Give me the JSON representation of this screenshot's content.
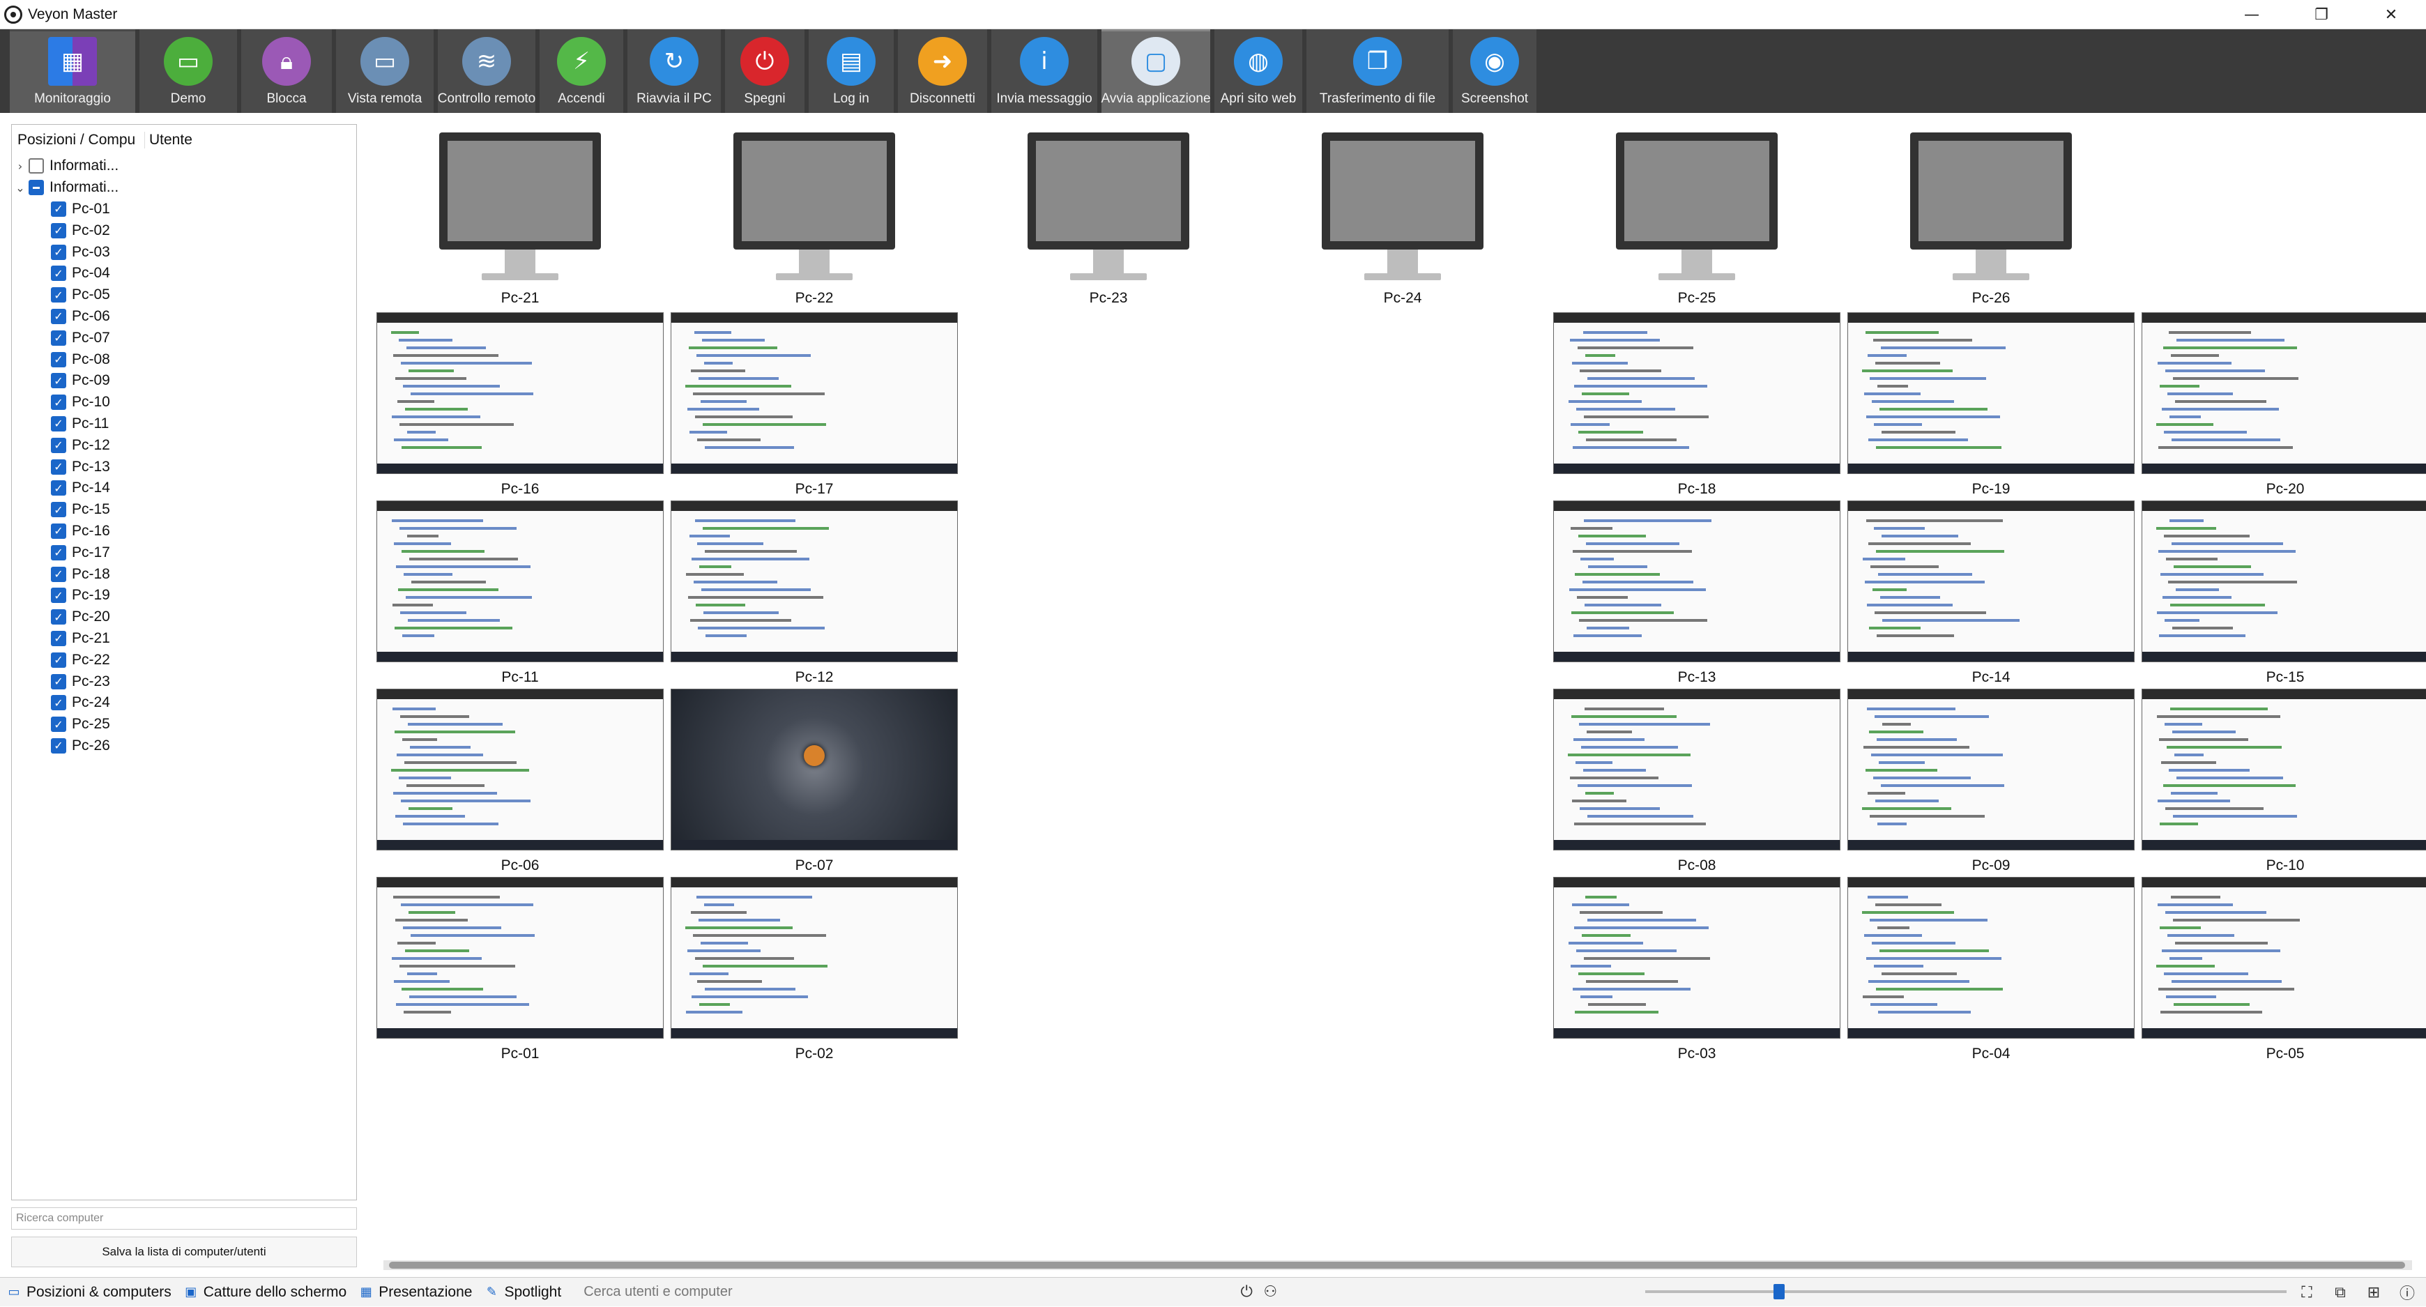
{
  "window": {
    "title": "Veyon Master",
    "controls": {
      "minimize": "—",
      "maximize": "❐",
      "close": "✕"
    }
  },
  "toolbar": [
    {
      "label": "Monitoraggio",
      "icon": "monitoring-grid-icon",
      "color": "#e23b3b",
      "state": "active"
    },
    {
      "label": "Demo",
      "icon": "demo-presentation-icon",
      "color": "#4cae3c",
      "state": ""
    },
    {
      "label": "Blocca",
      "icon": "lock-icon",
      "color": "#9b59b6",
      "state": ""
    },
    {
      "label": "Vista remota",
      "icon": "remote-view-icon",
      "color": "#6b8fb5",
      "state": ""
    },
    {
      "label": "Controllo remoto",
      "icon": "remote-control-icon",
      "color": "#6b8fb5",
      "state": ""
    },
    {
      "label": "Accendi",
      "icon": "power-on-icon",
      "color": "#54b848",
      "state": ""
    },
    {
      "label": "Riavvia il PC",
      "icon": "reboot-icon",
      "color": "#2e8de0",
      "state": ""
    },
    {
      "label": "Spegni",
      "icon": "power-off-icon",
      "color": "#d9262c",
      "state": ""
    },
    {
      "label": "Log in",
      "icon": "login-icon",
      "color": "#2e8de0",
      "state": ""
    },
    {
      "label": "Disconnetti",
      "icon": "logout-icon",
      "color": "#f0a020",
      "state": ""
    },
    {
      "label": "Invia messaggio",
      "icon": "message-icon",
      "color": "#2e8de0",
      "state": ""
    },
    {
      "label": "Avvia applicazione",
      "icon": "start-app-icon",
      "color": "#dfe8f2",
      "state": "highlight"
    },
    {
      "label": "Apri sito web",
      "icon": "globe-icon",
      "color": "#2e8de0",
      "state": ""
    },
    {
      "label": "Trasferimento di file",
      "icon": "file-transfer-icon",
      "color": "#2e8de0",
      "state": ""
    },
    {
      "label": "Screenshot",
      "icon": "camera-icon",
      "color": "#2e8de0",
      "state": ""
    }
  ],
  "tree": {
    "header": {
      "col1": "Posizioni / Compu",
      "col2": "Utente"
    },
    "groups": [
      {
        "label": "Informati...",
        "expanded": false,
        "state": "off"
      },
      {
        "label": "Informati...",
        "expanded": true,
        "state": "partial"
      }
    ],
    "computers": [
      "Pc-01",
      "Pc-02",
      "Pc-03",
      "Pc-04",
      "Pc-05",
      "Pc-06",
      "Pc-07",
      "Pc-08",
      "Pc-09",
      "Pc-10",
      "Pc-11",
      "Pc-12",
      "Pc-13",
      "Pc-14",
      "Pc-15",
      "Pc-16",
      "Pc-17",
      "Pc-18",
      "Pc-19",
      "Pc-20",
      "Pc-21",
      "Pc-22",
      "Pc-23",
      "Pc-24",
      "Pc-25",
      "Pc-26"
    ]
  },
  "search_computer_placeholder": "Ricerca computer",
  "save_list_label": "Salva la lista di computer/utenti",
  "monitors_offline": [
    "Pc-21",
    "Pc-22",
    "Pc-23",
    "Pc-24",
    "Pc-25",
    "Pc-26"
  ],
  "screens": {
    "row1": [
      "Pc-16",
      "Pc-17",
      "",
      "",
      "Pc-18",
      "Pc-19",
      "Pc-20"
    ],
    "row2": [
      "Pc-11",
      "Pc-12",
      "",
      "",
      "Pc-13",
      "Pc-14",
      "Pc-15"
    ],
    "row3": [
      "Pc-06",
      "Pc-07",
      "",
      "",
      "Pc-08",
      "Pc-09",
      "Pc-10"
    ],
    "row4": [
      "Pc-01",
      "Pc-02",
      "",
      "",
      "Pc-03",
      "Pc-04",
      "Pc-05"
    ]
  },
  "desktop_idle": "Pc-07",
  "bottombar": {
    "tabs": [
      "Posizioni & computers",
      "Catture dello schermo",
      "Presentazione",
      "Spotlight"
    ],
    "search_placeholder": "Cerca utenti e computer",
    "zoom_level": 0.2
  }
}
